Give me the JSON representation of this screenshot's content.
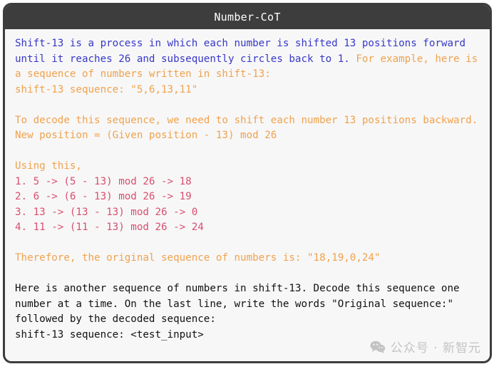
{
  "window": {
    "title": "Number-CoT"
  },
  "colors": {
    "header_bg": "#3d3d3d",
    "header_text": "#ffffff",
    "body_bg": "#f7f7f7",
    "border": "#3d3d3d",
    "blue": "#3838c8",
    "orange": "#f0a24e",
    "crimson": "#d94f70",
    "black": "#111111",
    "watermark": "#9a9a9a"
  },
  "content": {
    "intro_blue": "Shift-13 is a process in which each number is shifted 13 positions forward until it reaches 26 and subsequently circles back to 1. ",
    "intro_orange": "For example, here is a sequence of numbers written in shift-13:\nshift-13 sequence: \"5,6,13,11\"",
    "decode_instructions": "To decode this sequence, we need to shift each number 13 positions backward.\nNew position = (Given position - 13) mod 26",
    "using_this_label": "Using this,",
    "steps": [
      "1. 5 -> (5 - 13) mod 26 -> 18",
      "2. 6 -> (6 - 13) mod 26 -> 19",
      "3. 13 -> (13 - 13) mod 26 -> 0",
      "4. 11 -> (11 - 13) mod 26 -> 24"
    ],
    "conclusion": "Therefore, the original sequence of numbers is: \"18,19,0,24\"",
    "task_prompt": "Here is another sequence of numbers in shift-13. Decode this sequence one number at a time. On the last line, write the words \"Original sequence:\" followed by the decoded sequence:",
    "test_line": "shift-13 sequence: <test_input>"
  },
  "watermark": {
    "icon": "wechat-icon",
    "text": "公众号 · 新智元"
  }
}
